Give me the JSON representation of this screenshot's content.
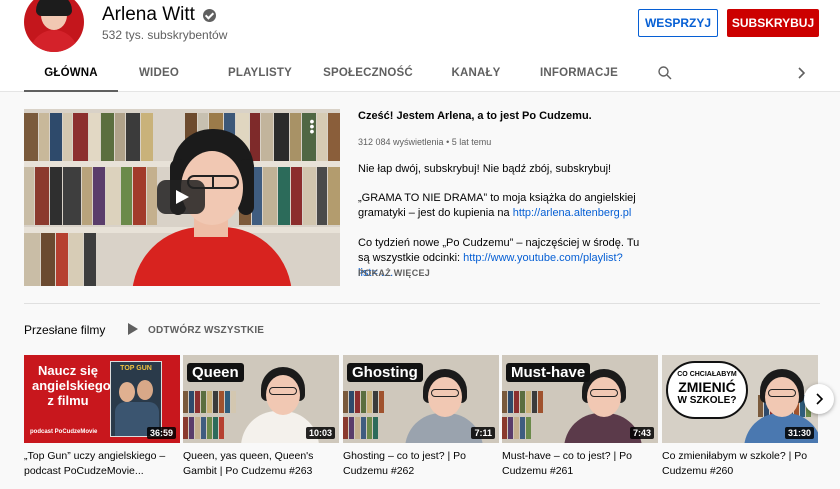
{
  "channel": {
    "name": "Arlena Witt",
    "subscribers": "532 tys. subskrybentów",
    "support_label": "WESPRZYJ",
    "subscribe_label": "SUBSKRYBUJ"
  },
  "tabs": [
    "GŁÓWNA",
    "WIDEO",
    "PLAYLISTY",
    "SPOŁECZNOŚĆ",
    "KANAŁY",
    "INFORMACJE"
  ],
  "featured": {
    "title": "Cześć! Jestem Arlena, a to jest Po Cudzemu.",
    "views": "312 084 wyświetlenia",
    "age": "5 lat temu",
    "desc1": "Nie łap dwój, subskrybuj! Nie bądź zbój, subskrybuj!",
    "desc2_text": "„GRAMA TO NIE DRAMA” to moja książka do angielskiej gramatyki – jest do kupienia na ",
    "desc2_link": "http://arlena.altenberg.pl",
    "desc3_text": "Co tydzień nowe „Po Cudzemu” – najczęściej w środę. Tu są wszystkie odcinki: ",
    "desc3_link": "http://www.youtube.com/playlist?list=.....",
    "show_more": "POKAŻ WIĘCEJ"
  },
  "section": {
    "title": "Przesłane filmy",
    "play_all": "ODTWÓRZ WSZYSTKIE"
  },
  "videos": [
    {
      "title": "„Top Gun” uczy angielskiego – podcast PoCudzeMovie...",
      "duration": "36:59",
      "thumb_text": "Naucz się angielskiego z filmu",
      "thumb_sub": "podcast PoCudzeMovie",
      "poster_text": "TOP GUN"
    },
    {
      "title": "Queen, yas queen, Queen's Gambit | Po Cudzemu #263",
      "duration": "10:03",
      "thumb_text": "Queen"
    },
    {
      "title": "Ghosting – co to jest? | Po Cudzemu #262",
      "duration": "7:11",
      "thumb_text": "Ghosting"
    },
    {
      "title": "Must-have – co to jest? | Po Cudzemu #261",
      "duration": "7:43",
      "thumb_text": "Must-have"
    },
    {
      "title": "Co zmieniłabym w szkole? | Po Cudzemu #260",
      "duration": "31:30",
      "thumb_line1": "CO CHCIAŁABYM",
      "thumb_line2": "ZMIENIĆ",
      "thumb_line3": "W SZKOLE?"
    }
  ],
  "colors": {
    "subscribe": "#cc0000",
    "link": "#065fd4"
  },
  "icons": [
    "verified-icon",
    "search-icon",
    "chevron-right-icon",
    "play-icon",
    "more-vert-icon",
    "next-arrow-icon"
  ]
}
